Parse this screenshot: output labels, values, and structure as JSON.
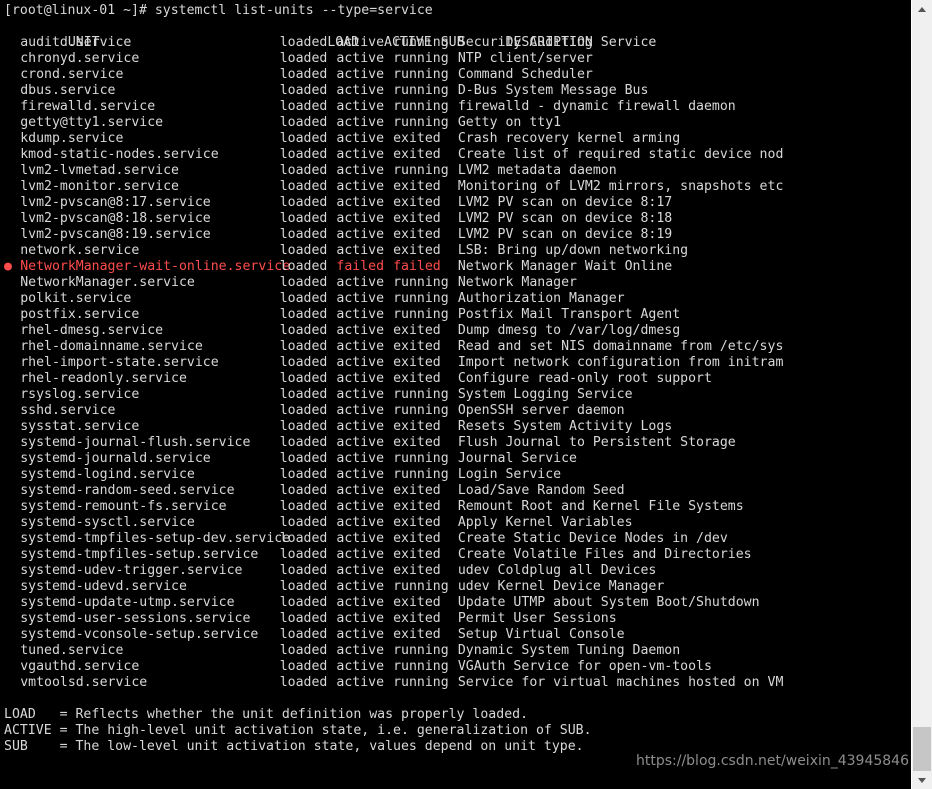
{
  "terminal": {
    "prompt": "[root@linux-01 ~]# systemctl list-units --type=service",
    "header": {
      "unit": "UNIT",
      "load": "LOAD",
      "active": "ACTIVE",
      "sub": "SUB",
      "description": "DESCRIPTION"
    },
    "rows": [
      {
        "bullet": "",
        "unit": "auditd.service",
        "load": "loaded",
        "active": "active",
        "sub": "running",
        "description": "Security Auditing Service",
        "failed": false
      },
      {
        "bullet": "",
        "unit": "chronyd.service",
        "load": "loaded",
        "active": "active",
        "sub": "running",
        "description": "NTP client/server",
        "failed": false
      },
      {
        "bullet": "",
        "unit": "crond.service",
        "load": "loaded",
        "active": "active",
        "sub": "running",
        "description": "Command Scheduler",
        "failed": false
      },
      {
        "bullet": "",
        "unit": "dbus.service",
        "load": "loaded",
        "active": "active",
        "sub": "running",
        "description": "D-Bus System Message Bus",
        "failed": false
      },
      {
        "bullet": "",
        "unit": "firewalld.service",
        "load": "loaded",
        "active": "active",
        "sub": "running",
        "description": "firewalld - dynamic firewall daemon",
        "failed": false
      },
      {
        "bullet": "",
        "unit": "getty@tty1.service",
        "load": "loaded",
        "active": "active",
        "sub": "running",
        "description": "Getty on tty1",
        "failed": false
      },
      {
        "bullet": "",
        "unit": "kdump.service",
        "load": "loaded",
        "active": "active",
        "sub": "exited",
        "description": "Crash recovery kernel arming",
        "failed": false
      },
      {
        "bullet": "",
        "unit": "kmod-static-nodes.service",
        "load": "loaded",
        "active": "active",
        "sub": "exited",
        "description": "Create list of required static device nod",
        "failed": false
      },
      {
        "bullet": "",
        "unit": "lvm2-lvmetad.service",
        "load": "loaded",
        "active": "active",
        "sub": "running",
        "description": "LVM2 metadata daemon",
        "failed": false
      },
      {
        "bullet": "",
        "unit": "lvm2-monitor.service",
        "load": "loaded",
        "active": "active",
        "sub": "exited",
        "description": "Monitoring of LVM2 mirrors, snapshots etc",
        "failed": false
      },
      {
        "bullet": "",
        "unit": "lvm2-pvscan@8:17.service",
        "load": "loaded",
        "active": "active",
        "sub": "exited",
        "description": "LVM2 PV scan on device 8:17",
        "failed": false
      },
      {
        "bullet": "",
        "unit": "lvm2-pvscan@8:18.service",
        "load": "loaded",
        "active": "active",
        "sub": "exited",
        "description": "LVM2 PV scan on device 8:18",
        "failed": false
      },
      {
        "bullet": "",
        "unit": "lvm2-pvscan@8:19.service",
        "load": "loaded",
        "active": "active",
        "sub": "exited",
        "description": "LVM2 PV scan on device 8:19",
        "failed": false
      },
      {
        "bullet": "",
        "unit": "network.service",
        "load": "loaded",
        "active": "active",
        "sub": "exited",
        "description": "LSB: Bring up/down networking",
        "failed": false
      },
      {
        "bullet": "●",
        "unit": "NetworkManager-wait-online.service",
        "load": "loaded",
        "active": "failed",
        "sub": "failed",
        "description": "Network Manager Wait Online",
        "failed": true
      },
      {
        "bullet": "",
        "unit": "NetworkManager.service",
        "load": "loaded",
        "active": "active",
        "sub": "running",
        "description": "Network Manager",
        "failed": false
      },
      {
        "bullet": "",
        "unit": "polkit.service",
        "load": "loaded",
        "active": "active",
        "sub": "running",
        "description": "Authorization Manager",
        "failed": false
      },
      {
        "bullet": "",
        "unit": "postfix.service",
        "load": "loaded",
        "active": "active",
        "sub": "running",
        "description": "Postfix Mail Transport Agent",
        "failed": false
      },
      {
        "bullet": "",
        "unit": "rhel-dmesg.service",
        "load": "loaded",
        "active": "active",
        "sub": "exited",
        "description": "Dump dmesg to /var/log/dmesg",
        "failed": false
      },
      {
        "bullet": "",
        "unit": "rhel-domainname.service",
        "load": "loaded",
        "active": "active",
        "sub": "exited",
        "description": "Read and set NIS domainname from /etc/sys",
        "failed": false
      },
      {
        "bullet": "",
        "unit": "rhel-import-state.service",
        "load": "loaded",
        "active": "active",
        "sub": "exited",
        "description": "Import network configuration from initram",
        "failed": false
      },
      {
        "bullet": "",
        "unit": "rhel-readonly.service",
        "load": "loaded",
        "active": "active",
        "sub": "exited",
        "description": "Configure read-only root support",
        "failed": false
      },
      {
        "bullet": "",
        "unit": "rsyslog.service",
        "load": "loaded",
        "active": "active",
        "sub": "running",
        "description": "System Logging Service",
        "failed": false
      },
      {
        "bullet": "",
        "unit": "sshd.service",
        "load": "loaded",
        "active": "active",
        "sub": "running",
        "description": "OpenSSH server daemon",
        "failed": false
      },
      {
        "bullet": "",
        "unit": "sysstat.service",
        "load": "loaded",
        "active": "active",
        "sub": "exited",
        "description": "Resets System Activity Logs",
        "failed": false
      },
      {
        "bullet": "",
        "unit": "systemd-journal-flush.service",
        "load": "loaded",
        "active": "active",
        "sub": "exited",
        "description": "Flush Journal to Persistent Storage",
        "failed": false
      },
      {
        "bullet": "",
        "unit": "systemd-journald.service",
        "load": "loaded",
        "active": "active",
        "sub": "running",
        "description": "Journal Service",
        "failed": false
      },
      {
        "bullet": "",
        "unit": "systemd-logind.service",
        "load": "loaded",
        "active": "active",
        "sub": "running",
        "description": "Login Service",
        "failed": false
      },
      {
        "bullet": "",
        "unit": "systemd-random-seed.service",
        "load": "loaded",
        "active": "active",
        "sub": "exited",
        "description": "Load/Save Random Seed",
        "failed": false
      },
      {
        "bullet": "",
        "unit": "systemd-remount-fs.service",
        "load": "loaded",
        "active": "active",
        "sub": "exited",
        "description": "Remount Root and Kernel File Systems",
        "failed": false
      },
      {
        "bullet": "",
        "unit": "systemd-sysctl.service",
        "load": "loaded",
        "active": "active",
        "sub": "exited",
        "description": "Apply Kernel Variables",
        "failed": false
      },
      {
        "bullet": "",
        "unit": "systemd-tmpfiles-setup-dev.service",
        "load": "loaded",
        "active": "active",
        "sub": "exited",
        "description": "Create Static Device Nodes in /dev",
        "failed": false
      },
      {
        "bullet": "",
        "unit": "systemd-tmpfiles-setup.service",
        "load": "loaded",
        "active": "active",
        "sub": "exited",
        "description": "Create Volatile Files and Directories",
        "failed": false
      },
      {
        "bullet": "",
        "unit": "systemd-udev-trigger.service",
        "load": "loaded",
        "active": "active",
        "sub": "exited",
        "description": "udev Coldplug all Devices",
        "failed": false
      },
      {
        "bullet": "",
        "unit": "systemd-udevd.service",
        "load": "loaded",
        "active": "active",
        "sub": "running",
        "description": "udev Kernel Device Manager",
        "failed": false
      },
      {
        "bullet": "",
        "unit": "systemd-update-utmp.service",
        "load": "loaded",
        "active": "active",
        "sub": "exited",
        "description": "Update UTMP about System Boot/Shutdown",
        "failed": false
      },
      {
        "bullet": "",
        "unit": "systemd-user-sessions.service",
        "load": "loaded",
        "active": "active",
        "sub": "exited",
        "description": "Permit User Sessions",
        "failed": false
      },
      {
        "bullet": "",
        "unit": "systemd-vconsole-setup.service",
        "load": "loaded",
        "active": "active",
        "sub": "exited",
        "description": "Setup Virtual Console",
        "failed": false
      },
      {
        "bullet": "",
        "unit": "tuned.service",
        "load": "loaded",
        "active": "active",
        "sub": "running",
        "description": "Dynamic System Tuning Daemon",
        "failed": false
      },
      {
        "bullet": "",
        "unit": "vgauthd.service",
        "load": "loaded",
        "active": "active",
        "sub": "running",
        "description": "VGAuth Service for open-vm-tools",
        "failed": false
      },
      {
        "bullet": "",
        "unit": "vmtoolsd.service",
        "load": "loaded",
        "active": "active",
        "sub": "running",
        "description": "Service for virtual machines hosted on VM",
        "failed": false
      }
    ],
    "legend": [
      "LOAD   = Reflects whether the unit definition was properly loaded.",
      "ACTIVE = The high-level unit activation state, i.e. generalization of SUB.",
      "SUB    = The low-level unit activation state, values depend on unit type."
    ],
    "watermark": "https://blog.csdn.net/weixin_43945846"
  },
  "colors": {
    "background": "#000000",
    "foreground": "#d8d8d8",
    "failed": "#ff4d4d",
    "watermark": "#8d8d8d",
    "scrollbar_track": "#f0f0f0",
    "scrollbar_thumb": "#c6c6c6"
  },
  "scrollbar": {
    "up_arrow": "scroll-up-arrow",
    "down_arrow": "scroll-down-arrow"
  }
}
